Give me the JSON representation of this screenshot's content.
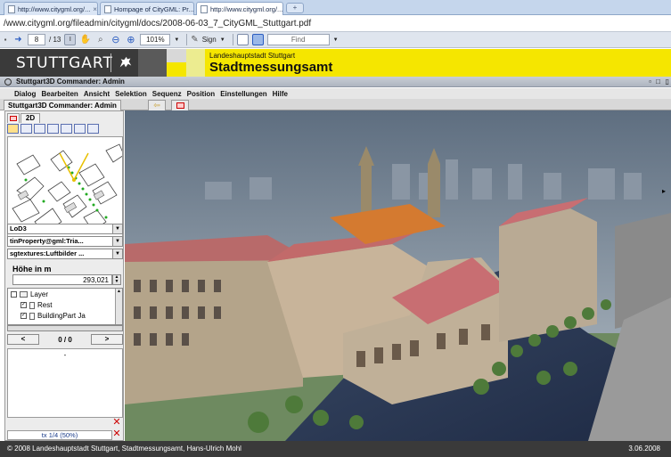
{
  "browser": {
    "tabs": [
      {
        "label": "http://www.citygml.org/..."
      },
      {
        "label": "Hompage of CityGML: Pr..."
      },
      {
        "label": "http://www.citygml.org/..."
      }
    ],
    "address": "/www.citygml.org/fileadmin/citygml/docs/2008-06-03_7_CityGML_Stuttgart.pdf"
  },
  "pdf_toolbar": {
    "page_current": "8",
    "page_total": "/ 13",
    "zoom": "101%",
    "sign_label": "Sign",
    "find_placeholder": "Find"
  },
  "banner": {
    "logo": "STUTTGART",
    "dept_top": "Landeshauptstadt Stuttgart",
    "dept_main": "Stadtmessungsamt",
    "colors": {
      "yellow": "#f5e600",
      "dark": "#3a3a3a"
    }
  },
  "app": {
    "window_title": "Stuttgart3D Commander: Admin",
    "menu": [
      "Dialog",
      "Bearbeiten",
      "Ansicht",
      "Selektion",
      "Sequenz",
      "Position",
      "Einstellungen",
      "Hilfe"
    ],
    "main_tab": "Stuttgart3D Commander: Admin"
  },
  "left_panel": {
    "view_tab": "2D",
    "lod_select": "LoD3",
    "property_select": "tinProperty@gml:Tria...",
    "texture_select": "sgtextures:Luftbilder ...",
    "hoehe_label": "Höhe in m",
    "hoehe_value": "293,021",
    "layers": [
      {
        "label": "Layer",
        "checked": false
      },
      {
        "label": "Rest",
        "checked": true
      },
      {
        "label": "BuildingPart Ja",
        "checked": true
      }
    ],
    "pager": {
      "prev": "<",
      "count": "0 / 0",
      "next": ">"
    },
    "list_placeholder": "-",
    "texture_status": "tx 1/4 (50%)"
  },
  "footer": {
    "copyright": "© 2008 Landeshauptstadt Stuttgart, Stadtmessungsamt, Hans-Ulrich Mohl",
    "date": "3.06.2008"
  }
}
